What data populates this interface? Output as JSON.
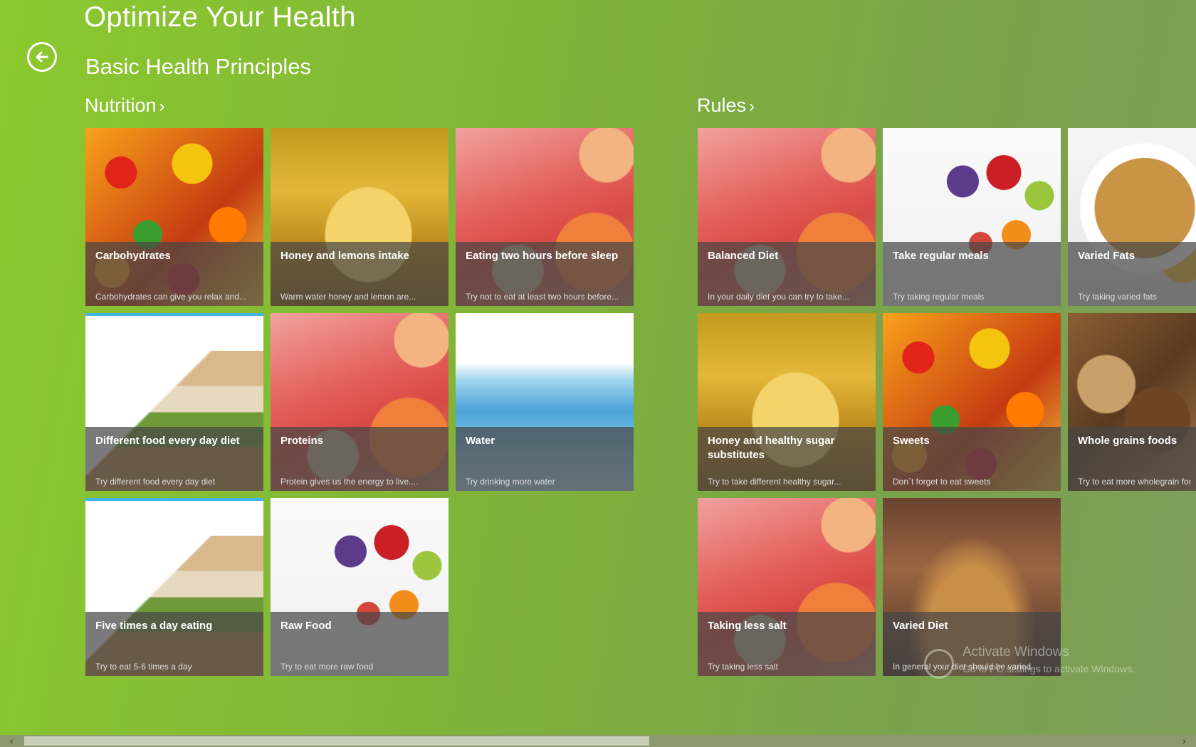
{
  "app": {
    "title": "Optimize Your Health"
  },
  "page": {
    "title": "Basic Health Principles"
  },
  "groups": [
    {
      "header": "Nutrition",
      "tiles": [
        {
          "title": "Carbohydrates",
          "subtitle": "Carbohydrates can give you relax and...",
          "image": "gummy-candy"
        },
        {
          "title": "Honey and lemons intake",
          "subtitle": "Warm water honey and lemon are...",
          "image": "honey-spoon"
        },
        {
          "title": "Eating two hours before sleep",
          "subtitle": "Try not to eat at least two hours before...",
          "image": "meat-salmon"
        },
        {
          "title": "Different food every day diet",
          "subtitle": "Try different food every day diet",
          "image": "food-pyramid"
        },
        {
          "title": "Proteins",
          "subtitle": "Protein gives us the energy to live....",
          "image": "meat-salmon"
        },
        {
          "title": "Water",
          "subtitle": "Try drinking more water",
          "image": "water-splash"
        },
        {
          "title": "Five times a day eating",
          "subtitle": "Try to eat 5-6 times a day",
          "image": "food-pyramid"
        },
        {
          "title": "Raw Food",
          "subtitle": "Try to eat more raw food",
          "image": "fruit-vegetables"
        }
      ]
    },
    {
      "header": "Rules",
      "tiles": [
        {
          "title": "Balanced Diet",
          "subtitle": "In your daily diet you can try to take...",
          "image": "meat-salmon"
        },
        {
          "title": "Take regular meals",
          "subtitle": "Try taking regular meals",
          "image": "fruit-vegetables"
        },
        {
          "title": "Varied Fats",
          "subtitle": "Try taking varied fats",
          "image": "breakfast-plate"
        },
        {
          "title": "Honey and healthy sugar substitutes",
          "subtitle": "Try to take different healthy sugar...",
          "image": "honey-spoon"
        },
        {
          "title": "Sweets",
          "subtitle": "Don`t forget to eat sweets",
          "image": "gummy-candy"
        },
        {
          "title": "Whole grains foods",
          "subtitle": "Try to eat more wholegrain foods",
          "image": "bread-grains"
        },
        {
          "title": "Taking less salt",
          "subtitle": "Try taking less salt",
          "image": "meat-salmon"
        },
        {
          "title": "Varied Diet",
          "subtitle": "In general your diet should be varied...",
          "image": "sunset-sea"
        }
      ]
    }
  ],
  "watermark": {
    "line1": "Activate Windows",
    "line2": "Go to PC settings to activate Windows."
  },
  "icons": {
    "back": "back-arrow-icon",
    "chevron": "chevron-right-icon"
  }
}
